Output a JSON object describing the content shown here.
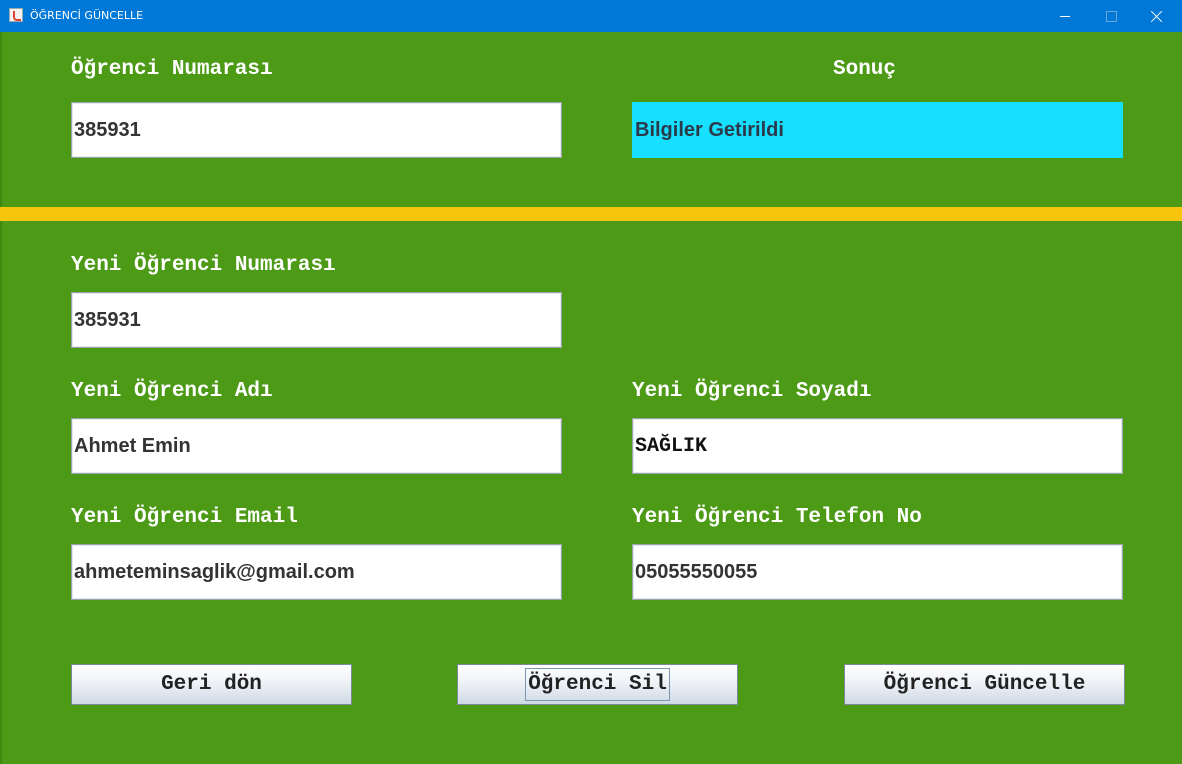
{
  "window": {
    "title": "ÖĞRENCİ GÜNCELLE"
  },
  "top": {
    "student_no_label": "Öğrenci Numarası",
    "student_no_value": "385931",
    "result_label": "Sonuç",
    "result_value": "Bilgiler Getirildi"
  },
  "form": {
    "new_no_label": "Yeni Öğrenci Numarası",
    "new_no_value": "385931",
    "new_name_label": "Yeni Öğrenci Adı",
    "new_name_value": "Ahmet Emin",
    "new_surname_label": "Yeni Öğrenci Soyadı",
    "new_surname_value": "SAĞLIK",
    "new_email_label": "Yeni Öğrenci Email",
    "new_email_value": "ahmeteminsaglik@gmail.com",
    "new_phone_label": "Yeni Öğrenci Telefon No",
    "new_phone_value": "05055550055"
  },
  "buttons": {
    "back": "Geri dön",
    "delete": "Öğrenci Sil",
    "update": "Öğrenci Güncelle"
  },
  "colors": {
    "background": "#4c9a16",
    "titlebar": "#0078d7",
    "divider": "#f7c50c",
    "result_field": "#17dfff"
  }
}
